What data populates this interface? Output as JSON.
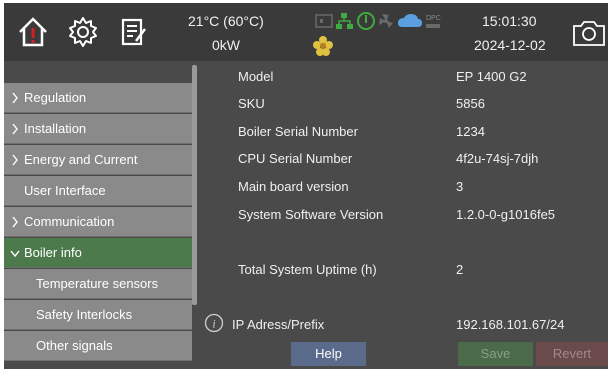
{
  "header": {
    "temperature": "21°C (60°C)",
    "power": "0kW",
    "time": "15:01:30",
    "date": "2024-12-02",
    "status_text": "DPC"
  },
  "sidebar": {
    "items": [
      {
        "label": "Regulation",
        "chevron": true
      },
      {
        "label": "Installation",
        "chevron": true
      },
      {
        "label": "Energy and Current",
        "chevron": true
      },
      {
        "label": "User Interface",
        "chevron": false
      },
      {
        "label": "Communication",
        "chevron": true
      },
      {
        "label": "Boiler info",
        "chevron": true,
        "expanded": true
      },
      {
        "label": "Temperature sensors",
        "sub": true
      },
      {
        "label": "Safety Interlocks",
        "sub": true
      },
      {
        "label": "Other signals",
        "sub": true
      }
    ]
  },
  "info": {
    "model_label": "Model",
    "model_value": "EP 1400 G2",
    "sku_label": "SKU",
    "sku_value": "5856",
    "serial_label": "Boiler Serial Number",
    "serial_value": "1234",
    "cpu_label": "CPU Serial Number",
    "cpu_value": "4f2u-74sj-7djh",
    "board_label": "Main board version",
    "board_value": "3",
    "software_label": "System Software Version",
    "software_value": "1.2.0-0-g1016fe5",
    "uptime_label": "Total System Uptime (h)",
    "uptime_value": "2",
    "ip_label": "IP Adress/Prefix",
    "ip_value": "192.168.101.67/24"
  },
  "buttons": {
    "help": "Help",
    "save": "Save",
    "revert": "Revert"
  },
  "colors": {
    "active_item": "#4d7a4d",
    "alarm_red": "#d02020",
    "status_green": "#3faa3f",
    "status_blue": "#5aa0e0"
  }
}
